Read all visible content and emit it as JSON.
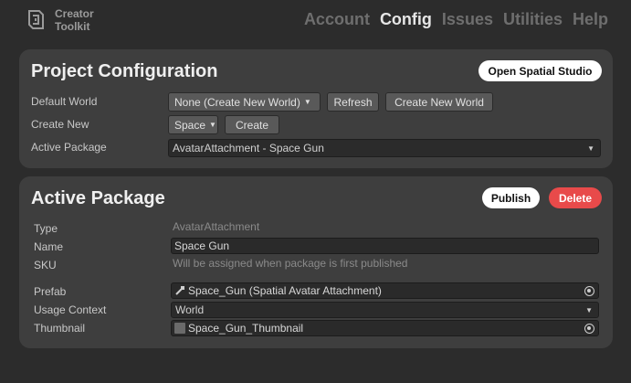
{
  "app": {
    "logo_line1": "Creator",
    "logo_line2": "Toolkit"
  },
  "nav": {
    "items": [
      "Account",
      "Config",
      "Issues",
      "Utilities",
      "Help"
    ],
    "active": "Config"
  },
  "project_config": {
    "title": "Project Configuration",
    "open_studio_label": "Open Spatial Studio",
    "default_world_label": "Default World",
    "default_world_value": "None (Create New World)",
    "refresh_label": "Refresh",
    "create_new_world_label": "Create New World",
    "create_new_label": "Create New",
    "create_new_type": "Space",
    "create_label": "Create",
    "active_package_label": "Active Package",
    "active_package_value": "AvatarAttachment - Space Gun"
  },
  "active_package": {
    "title": "Active Package",
    "publish_label": "Publish",
    "delete_label": "Delete",
    "type_label": "Type",
    "type_value": "AvatarAttachment",
    "name_label": "Name",
    "name_value": "Space Gun",
    "sku_label": "SKU",
    "sku_value": "Will be assigned when package is first published",
    "prefab_label": "Prefab",
    "prefab_value": "Space_Gun (Spatial Avatar Attachment)",
    "usage_context_label": "Usage Context",
    "usage_context_value": "World",
    "thumbnail_label": "Thumbnail",
    "thumbnail_value": "Space_Gun_Thumbnail"
  },
  "colors": {
    "background": "#2c2c2c",
    "card": "#3e3e3e",
    "delete_accent": "#e84a4a",
    "nav_active": "#e6e6e6",
    "nav_inactive": "#6e6e6e"
  },
  "icons": {
    "logo": "creator-toolkit-logo-icon",
    "object_picker": "object-picker-icon",
    "prefab": "prefab-icon",
    "thumbnail": "texture-icon"
  }
}
